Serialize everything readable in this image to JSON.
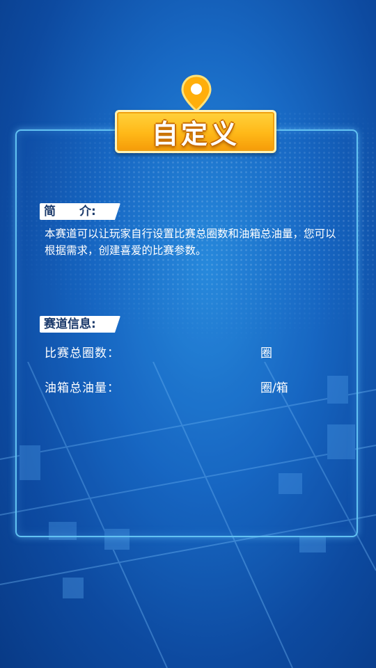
{
  "title": "自定义",
  "intro": {
    "tag": "简　　介:",
    "text": "本赛道可以让玩家自行设置比赛总圈数和油箱总油量，您可以根据需求，创建喜爱的比赛参数。"
  },
  "track_info": {
    "tag": "赛道信息:",
    "rows": [
      {
        "label": "比赛总圈数：",
        "value": "",
        "unit": "圈"
      },
      {
        "label": "油箱总油量：",
        "value": "",
        "unit": "圈/箱"
      }
    ]
  },
  "colors": {
    "background": "#1869c4",
    "panel_border": "#62c2f2",
    "banner": "#ffb818",
    "pin": "#ffae0a"
  },
  "icons": {
    "pin": "location-pin-icon"
  }
}
